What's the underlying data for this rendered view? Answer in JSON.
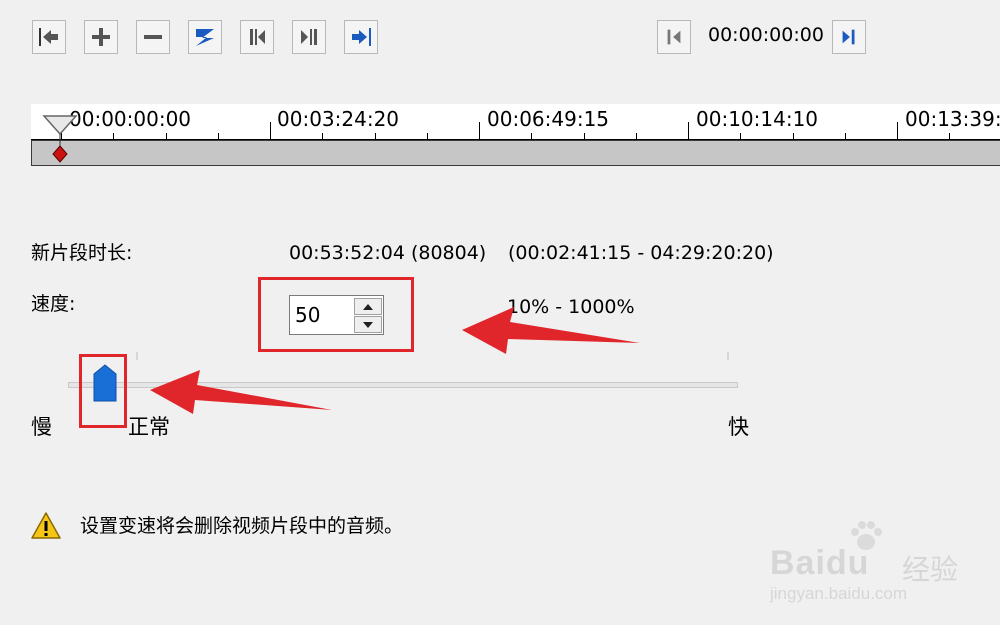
{
  "toolbar": {
    "buttons": [
      {
        "name": "go-start-button",
        "icon": "arrow-left-bar-icon"
      },
      {
        "name": "add-button",
        "icon": "plus-icon"
      },
      {
        "name": "remove-button",
        "icon": "minus-icon"
      },
      {
        "name": "split-button",
        "icon": "split-icon"
      },
      {
        "name": "prev-frame-button",
        "icon": "step-back-icon"
      },
      {
        "name": "next-frame-button",
        "icon": "step-forward-icon"
      },
      {
        "name": "go-end-button",
        "icon": "arrow-right-bar-icon"
      }
    ],
    "timecode": "00:00:00:00"
  },
  "timeline": {
    "labels": [
      "00:00:00:00",
      "00:03:24:20",
      "00:06:49:15",
      "00:10:14:10",
      "00:13:39:"
    ]
  },
  "info": {
    "duration_label": "新片段时长:",
    "duration_value": "00:53:52:04 (80804)",
    "duration_range": "(00:02:41:15 - 04:29:20:20)",
    "speed_label": "速度:",
    "speed_value": "50",
    "speed_range": "10% - 1000%"
  },
  "slider": {
    "slow_label": "慢",
    "normal_label": "正常",
    "fast_label": "快",
    "value_percent": 50
  },
  "warning": {
    "icon": "warning-icon",
    "text": "设置变速将会删除视频片段中的音频。"
  },
  "watermark": {
    "brand": "Baidu",
    "sub": "经验",
    "url": "jingyan.baidu.com"
  },
  "colors": {
    "accent_blue": "#1a6fd6",
    "annotation_red": "#e0262a",
    "marker_red": "#cc1111"
  }
}
